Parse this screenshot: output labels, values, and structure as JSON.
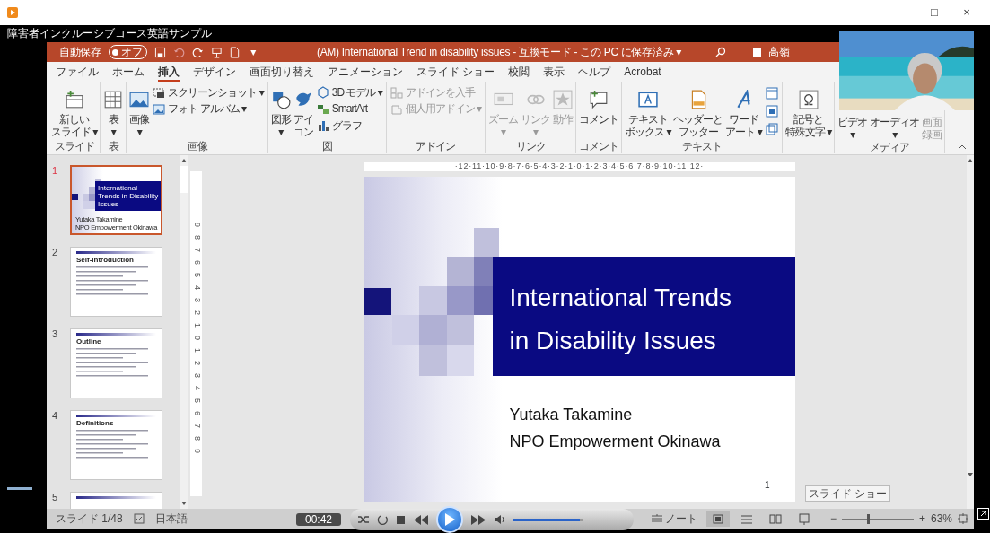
{
  "player": {
    "title": "障害者インクルーシブコース英語サンプル",
    "window_buttons": [
      "–",
      "□",
      "×"
    ],
    "time": "00:42",
    "volume": {
      "level": 0.95
    }
  },
  "powerpoint": {
    "title_bar": {
      "autosave_label": "自動保存",
      "autosave_toggle": {
        "label": "オフ",
        "on": false
      },
      "customize": "▾",
      "document": "(AM) International Trend in disability issues - 互換モード - この PC に保存済み ▾",
      "user": "高嶺"
    },
    "tabs": [
      {
        "label": "ファイル",
        "selected": false
      },
      {
        "label": "ホーム",
        "selected": false
      },
      {
        "label": "挿入",
        "selected": true
      },
      {
        "label": "デザイン",
        "selected": false
      },
      {
        "label": "画面切り替え",
        "selected": false
      },
      {
        "label": "アニメーション",
        "selected": false
      },
      {
        "label": "スライド ショー",
        "selected": false
      },
      {
        "label": "校閲",
        "selected": false
      },
      {
        "label": "表示",
        "selected": false
      },
      {
        "label": "ヘルプ",
        "selected": false
      },
      {
        "label": "Acrobat",
        "selected": false
      }
    ],
    "ribbon": [
      {
        "label": "スライド",
        "items": [
          {
            "kind": "large",
            "lines": [
              "新しい",
              "スライド ▾"
            ],
            "disabled": false
          }
        ]
      },
      {
        "label": "表",
        "items": [
          {
            "kind": "large",
            "lines": [
              "表",
              "▾"
            ],
            "disabled": false
          }
        ]
      },
      {
        "label": "画像",
        "items": [
          {
            "kind": "large",
            "lines": [
              "画像",
              "▾"
            ],
            "disabled": false
          },
          {
            "kind": "small",
            "lines": [
              "スクリーンショット ▾"
            ],
            "disabled": false
          },
          {
            "kind": "small",
            "lines": [
              "フォト アルバム ▾"
            ],
            "disabled": false
          }
        ]
      },
      {
        "label": "図",
        "items": [
          {
            "kind": "large",
            "lines": [
              "図形",
              "▾"
            ],
            "disabled": false
          },
          {
            "kind": "large",
            "lines": [
              "アイ",
              "コン"
            ],
            "disabled": false
          },
          {
            "kind": "small",
            "lines": [
              "3D モデル ▾"
            ],
            "disabled": false
          },
          {
            "kind": "small",
            "lines": [
              "SmartArt"
            ],
            "disabled": false
          },
          {
            "kind": "small",
            "lines": [
              "グラフ"
            ],
            "disabled": false
          }
        ]
      },
      {
        "label": "アドイン",
        "items": [
          {
            "kind": "small",
            "lines": [
              "アドインを入手"
            ],
            "disabled": true
          },
          {
            "kind": "small",
            "lines": [
              "個人用アドイン ▾"
            ],
            "disabled": true
          }
        ]
      },
      {
        "label": "リンク",
        "items": [
          {
            "kind": "large",
            "lines": [
              "ズーム",
              "▾"
            ],
            "disabled": true
          },
          {
            "kind": "large",
            "lines": [
              "リンク",
              "▾"
            ],
            "disabled": true
          },
          {
            "kind": "large",
            "lines": [
              "動作"
            ],
            "disabled": true
          }
        ]
      },
      {
        "label": "コメント",
        "items": [
          {
            "kind": "large",
            "lines": [
              "コメント"
            ],
            "disabled": false
          }
        ]
      },
      {
        "label": "テキスト",
        "items": [
          {
            "kind": "large",
            "lines": [
              "テキスト",
              "ボックス ▾"
            ],
            "disabled": false
          },
          {
            "kind": "large",
            "lines": [
              "ヘッダーと",
              "フッター"
            ],
            "disabled": false
          },
          {
            "kind": "large",
            "lines": [
              "ワード",
              "アート ▾"
            ],
            "disabled": false
          },
          {
            "kind": "icon",
            "disabled": false
          },
          {
            "kind": "icon",
            "disabled": false
          },
          {
            "kind": "icon",
            "disabled": false
          }
        ]
      },
      {
        "items": [
          {
            "kind": "large",
            "lines": [
              "記号と",
              "特殊文字 ▾"
            ],
            "disabled": false
          }
        ]
      },
      {
        "label": "メディア",
        "items": [
          {
            "kind": "large",
            "lines": [
              "ビデオ",
              "▾"
            ],
            "disabled": false
          },
          {
            "kind": "large",
            "lines": [
              "オーディオ",
              "▾"
            ],
            "disabled": false
          },
          {
            "kind": "large",
            "lines": [
              "画面",
              "録画"
            ],
            "disabled": true
          }
        ]
      }
    ],
    "thumbnails": [
      {
        "number": "1",
        "selected": true,
        "kind": "title",
        "title": "International Trends in Disability Issues",
        "subtitle": [
          "Yutaka Takamine",
          "NPO Empowerment Okinawa"
        ]
      },
      {
        "number": "2",
        "selected": false,
        "kind": "content",
        "title": "Self-introduction"
      },
      {
        "number": "3",
        "selected": false,
        "kind": "content",
        "title": "Outline"
      },
      {
        "number": "4",
        "selected": false,
        "kind": "content",
        "title": "Definitions"
      },
      {
        "number": "5",
        "selected": false,
        "kind": "content"
      }
    ],
    "ruler": "·12·11·10·9·8·7·6·5·4·3·2·1·0·1·2·3·4·5·6·7·8·9·10·11·12·",
    "vertical_ruler": "9·8·7·6·5·4·3·2·1·0·1·2·3·4·5·6·7·8·9",
    "slide": {
      "title_lines": [
        "International Trends",
        "in Disability Issues"
      ],
      "subtitle_lines": [
        "Yutaka Takamine",
        "NPO Empowerment Okinawa"
      ],
      "page": "1"
    },
    "tooltip": "スライド ショー",
    "status": {
      "slide": "スライド 1/48",
      "language": "日本語",
      "notes": "ノート",
      "views": [
        {
          "selected": true
        },
        {
          "selected": false
        },
        {
          "selected": false
        },
        {
          "selected": false
        }
      ],
      "zoom_out": "−",
      "zoom_in": "+",
      "zoom": {
        "level": 0.35
      },
      "zoom_percent": "63%"
    }
  }
}
